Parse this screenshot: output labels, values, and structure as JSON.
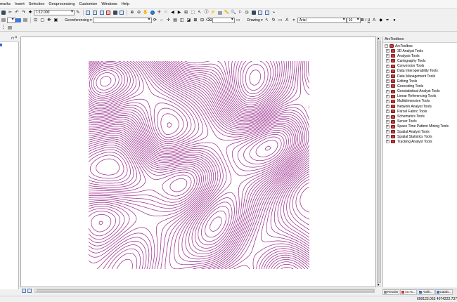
{
  "menu": {
    "items": [
      "marks",
      "Insert",
      "Selection",
      "Geoprocessing",
      "Customize",
      "Windows",
      "Help"
    ]
  },
  "standard_toolbar": {
    "scale_value": "1:12.000"
  },
  "georef_toolbar": {
    "label": "Georeferencing ▾"
  },
  "draw_toolbar": {
    "label": "Drawing ▾",
    "font_name": "Arial",
    "font_size": "10",
    "bold": "B",
    "italic": "I",
    "underline": "U",
    "text_A": "A"
  },
  "toolbox": {
    "root": "ArcToolbox",
    "items": [
      "3D Analyst Tools",
      "Analysis Tools",
      "Cartography Tools",
      "Conversion Tools",
      "Data Interoperability Tools",
      "Data Management Tools",
      "Editing Tools",
      "Geocoding Tools",
      "Geostatistical Analyst Tools",
      "Linear Referencing Tools",
      "Multidimension Tools",
      "Network Analyst Tools",
      "Parcel Fabric Tools",
      "Schematics Tools",
      "Server Tools",
      "Space Time Pattern Mining Tools",
      "Spatial Analyst Tools",
      "Spatial Statistics Tools",
      "Tracking Analyst Tools"
    ]
  },
  "dock_tabs": [
    "Results",
    "ArcTo...",
    "Attrib...",
    "Catalo..."
  ],
  "status": {
    "coordinates": "699123.063  4074222.737"
  },
  "colors": {
    "contour_line": "#9b2d8e",
    "toolbox_icon": "#c7383d"
  }
}
